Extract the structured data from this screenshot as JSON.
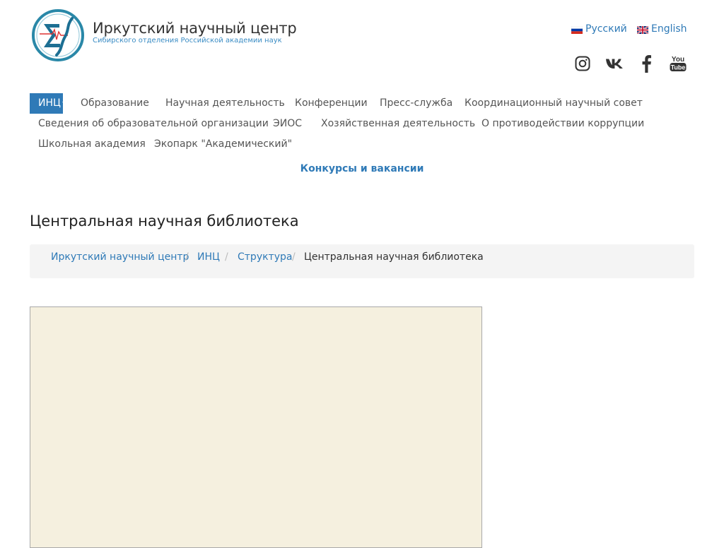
{
  "header": {
    "title": "Иркутский научный центр",
    "subtitle": "Сибирского отделения Российской академии наук"
  },
  "languages": [
    {
      "label": "Русский",
      "flag": "ru-flag-icon"
    },
    {
      "label": "English",
      "flag": "uk-flag-icon"
    }
  ],
  "social": [
    "instagram-icon",
    "vk-icon",
    "facebook-icon",
    "youtube-icon"
  ],
  "social_text": {
    "youtube_top": "You",
    "youtube_bottom": "Tube"
  },
  "nav": {
    "active": "ИНЦ",
    "items": [
      "Образование",
      "Научная деятельность",
      "Конференции",
      "Пресс-служба",
      "Координационный научный совет",
      "Сведения об образовательной организации",
      "ЭИОС",
      "Хозяйственная деятельность",
      "О противодействии коррупции",
      "Школьная академия",
      "Экопарк \"Академический\""
    ]
  },
  "featured_link": "Конкурсы и вакансии",
  "page": {
    "title": "Центральная научная библиотека"
  },
  "breadcrumb": {
    "items": [
      "Иркутский научный центр",
      "ИНЦ",
      "Структура",
      "Центральная научная библиотека"
    ],
    "separator": "/"
  },
  "colors": {
    "accent": "#2f7ab7",
    "map_background": "#f5f0df",
    "breadcrumb_bg": "#f4f4f4"
  }
}
